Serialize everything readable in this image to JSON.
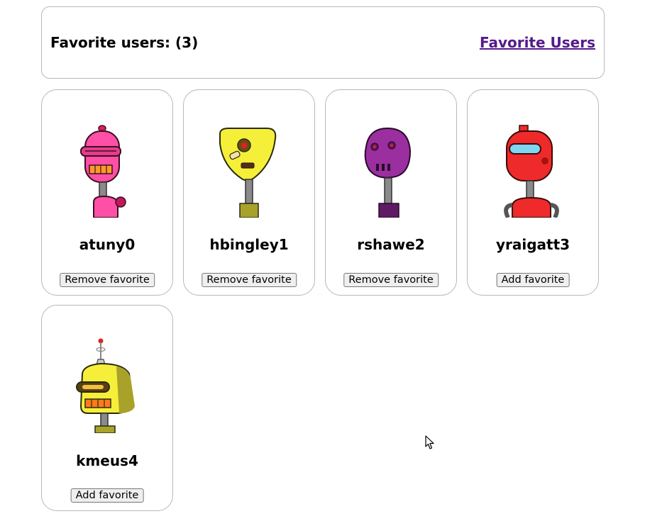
{
  "header": {
    "title": "Favorite users: (3)",
    "link_label": "Favorite Users"
  },
  "users": [
    {
      "username": "atuny0",
      "button_label": "Remove favorite",
      "color": "#ff4fa6",
      "dark": "#c2185b"
    },
    {
      "username": "hbingley1",
      "button_label": "Remove favorite",
      "color": "#f5ef3a",
      "dark": "#a8a22a"
    },
    {
      "username": "rshawe2",
      "button_label": "Remove favorite",
      "color": "#9b2fa0",
      "dark": "#5e1a63"
    },
    {
      "username": "yraigatt3",
      "button_label": "Add favorite",
      "color": "#ef2a2a",
      "dark": "#a61212"
    },
    {
      "username": "kmeus4",
      "button_label": "Add favorite",
      "color": "#f5ef3a",
      "dark": "#a8a22a"
    }
  ]
}
